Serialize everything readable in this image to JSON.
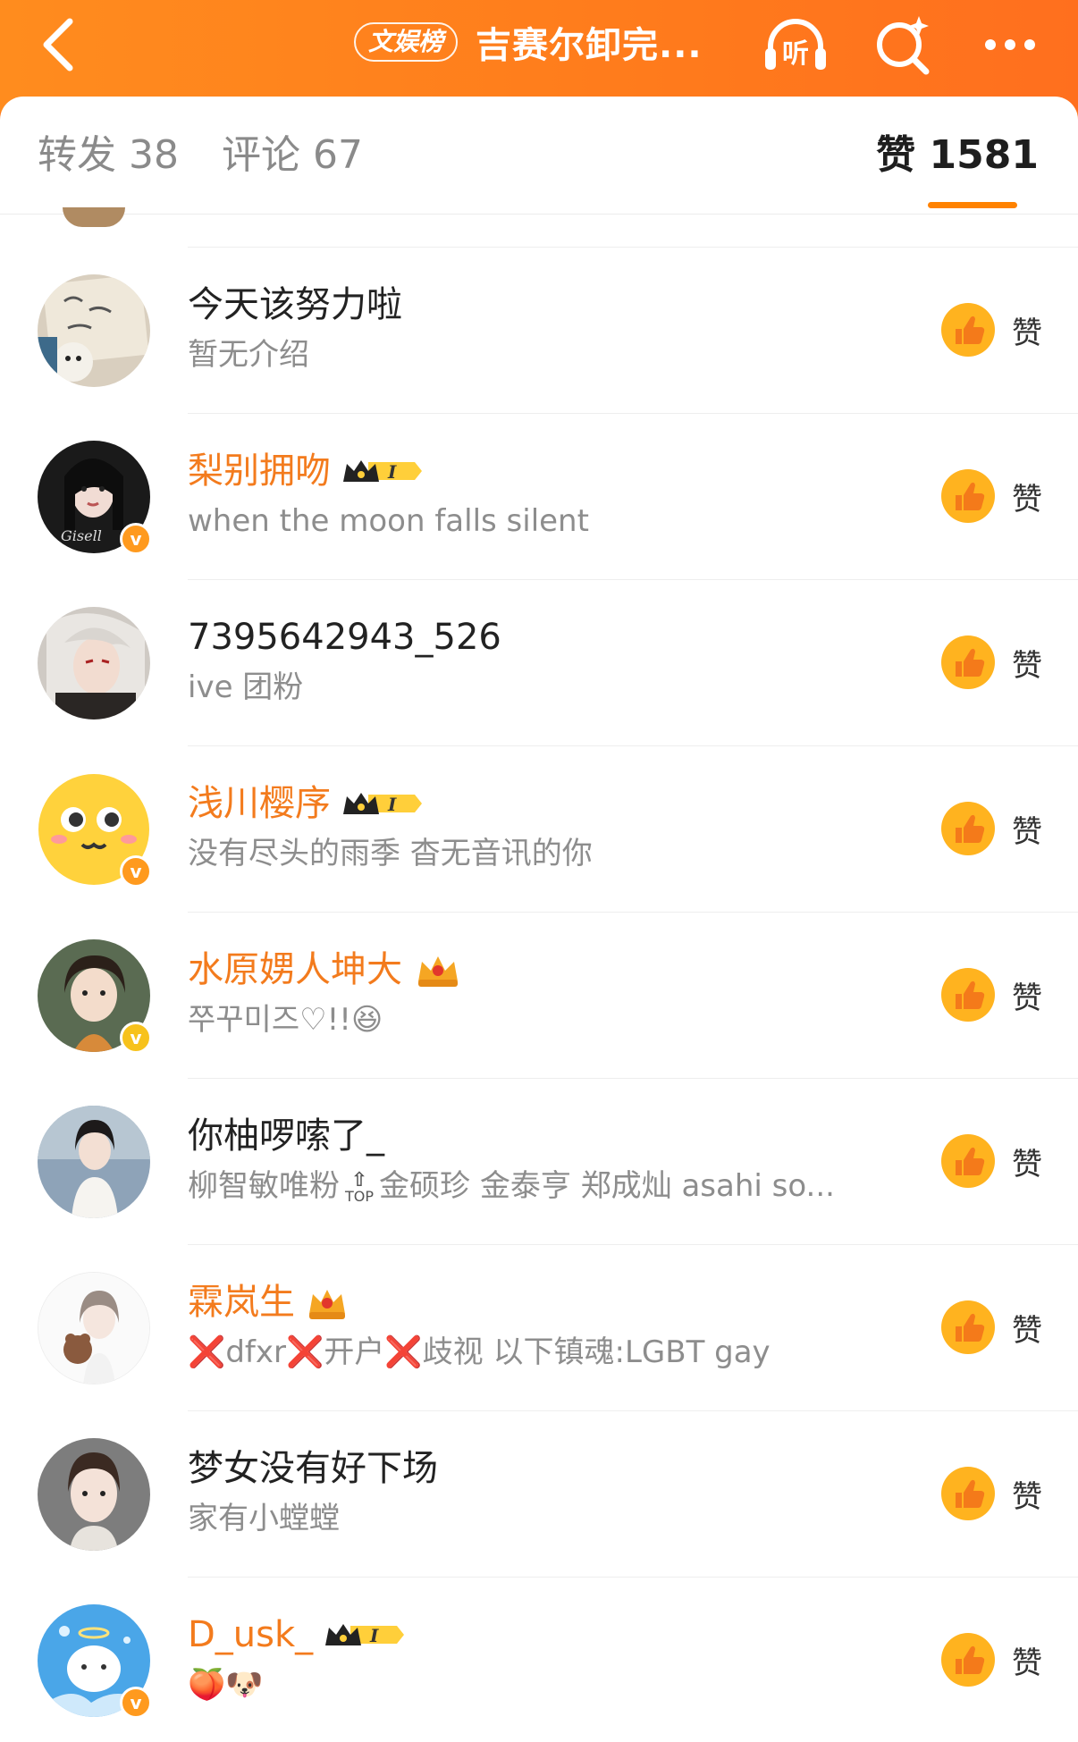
{
  "header": {
    "rank_badge": "文娱榜",
    "title": "吉赛尔卸完...",
    "listen_label": "听"
  },
  "tabs": {
    "repost": "转发 38",
    "comment": "评论 67",
    "like": "赞 1581"
  },
  "colors": {
    "brand": "#ff8200",
    "vip_name": "#f37b1d",
    "like_icon": "#ffb31f"
  },
  "like_label": "赞",
  "users": [
    {
      "name": "今天该努力啦",
      "bio": "暂无介绍",
      "vip": false
    },
    {
      "name": "梨别拥吻",
      "bio": "when the moon falls silent",
      "vip": true,
      "verified": "v"
    },
    {
      "name": "7395642943_526",
      "bio": "ive 团粉",
      "vip": false
    },
    {
      "name": "浅川樱序",
      "bio": "没有尽头的雨季 杳无音讯的你",
      "vip": true,
      "verified": "v"
    },
    {
      "name": "水原娚人坤大",
      "bio": "쭈꾸미즈♡!!😆",
      "vip": true,
      "verified": "v"
    },
    {
      "name": "你柚啰嗦了_",
      "bio_a": "柳智敏唯粉",
      "bio_top": "TOP",
      "bio_b": "金硕珍 金泰亨 郑成灿 asahi so...",
      "vip": false
    },
    {
      "name": "霖岚生",
      "bio_parts": [
        "❌",
        "dfxr",
        "❌",
        "开户",
        "❌",
        "歧视 以下镇魂:LGBT  gay"
      ],
      "vip": true
    },
    {
      "name": "梦女没有好下场",
      "bio": "家有小螳螳",
      "vip": false
    },
    {
      "name": "D_usk_",
      "bio": "🍑🐶",
      "vip": true,
      "verified": "v"
    }
  ]
}
